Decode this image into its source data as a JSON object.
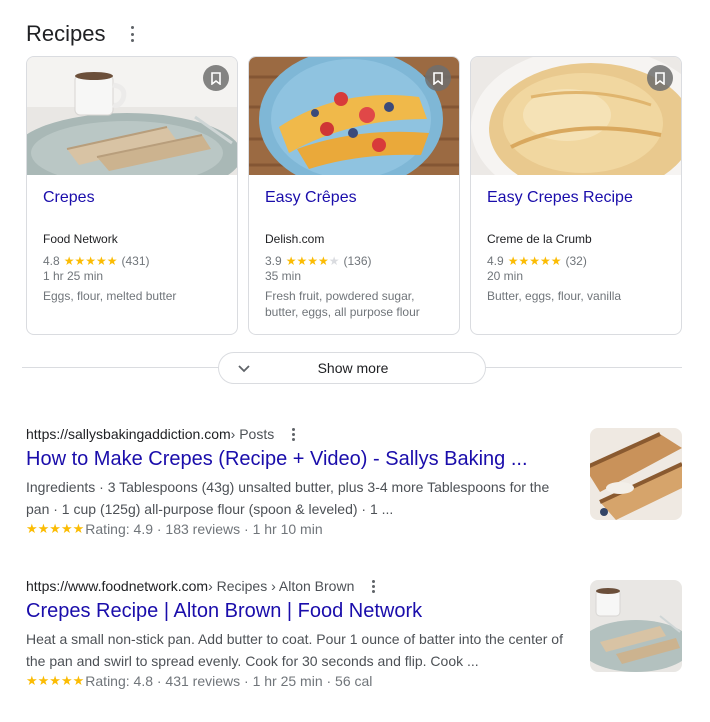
{
  "header": {
    "title": "Recipes",
    "menu_icon": "more-vert-icon"
  },
  "cards": [
    {
      "title": "Crepes",
      "source": "Food Network",
      "rating": "4.8",
      "stars": 5,
      "reviews": "(431)",
      "time": "1 hr 25 min",
      "ingredients": "Eggs, flour, melted butter"
    },
    {
      "title": "Easy Crêpes",
      "source": "Delish.com",
      "rating": "3.9",
      "stars": 4,
      "reviews": "(136)",
      "time": "35 min",
      "ingredients": "Fresh fruit, powdered sugar, butter, eggs, all purpose flour"
    },
    {
      "title": "Easy Crepes Recipe",
      "source": "Creme de la Crumb",
      "rating": "4.9",
      "stars": 5,
      "reviews": "(32)",
      "time": "20 min",
      "ingredients": "Butter, eggs, flour, vanilla"
    }
  ],
  "show_more": {
    "label": "Show more",
    "icon": "chevron-down-icon"
  },
  "results": [
    {
      "url": "https://sallysbakingaddiction.com",
      "breadcrumb": " › Posts",
      "title": "How to Make Crepes (Recipe + Video) - Sallys Baking ...",
      "snippet": "Ingredients · 3 Tablespoons (43g) unsalted butter, plus 3-4 more Tablespoons for the pan · 1 cup (125g) all-purpose flour (spoon & leveled) · 1 ...",
      "meta": "Rating: 4.9 · 183 reviews · 1 hr 10 min"
    },
    {
      "url": "https://www.foodnetwork.com",
      "breadcrumb": " › Recipes › Alton Brown",
      "title": "Crepes Recipe | Alton Brown | Food Network",
      "snippet": "Heat a small non-stick pan. Add butter to coat. Pour 1 ounce of batter into the center of the pan and swirl to spread evenly. Cook for 30 seconds and flip. Cook ...",
      "meta": "Rating: 4.8 · 431 reviews · 1 hr 25 min · 56 cal"
    }
  ],
  "colors": {
    "link": "#1a0dab",
    "star": "#fbbc04",
    "muted": "#70757a"
  }
}
